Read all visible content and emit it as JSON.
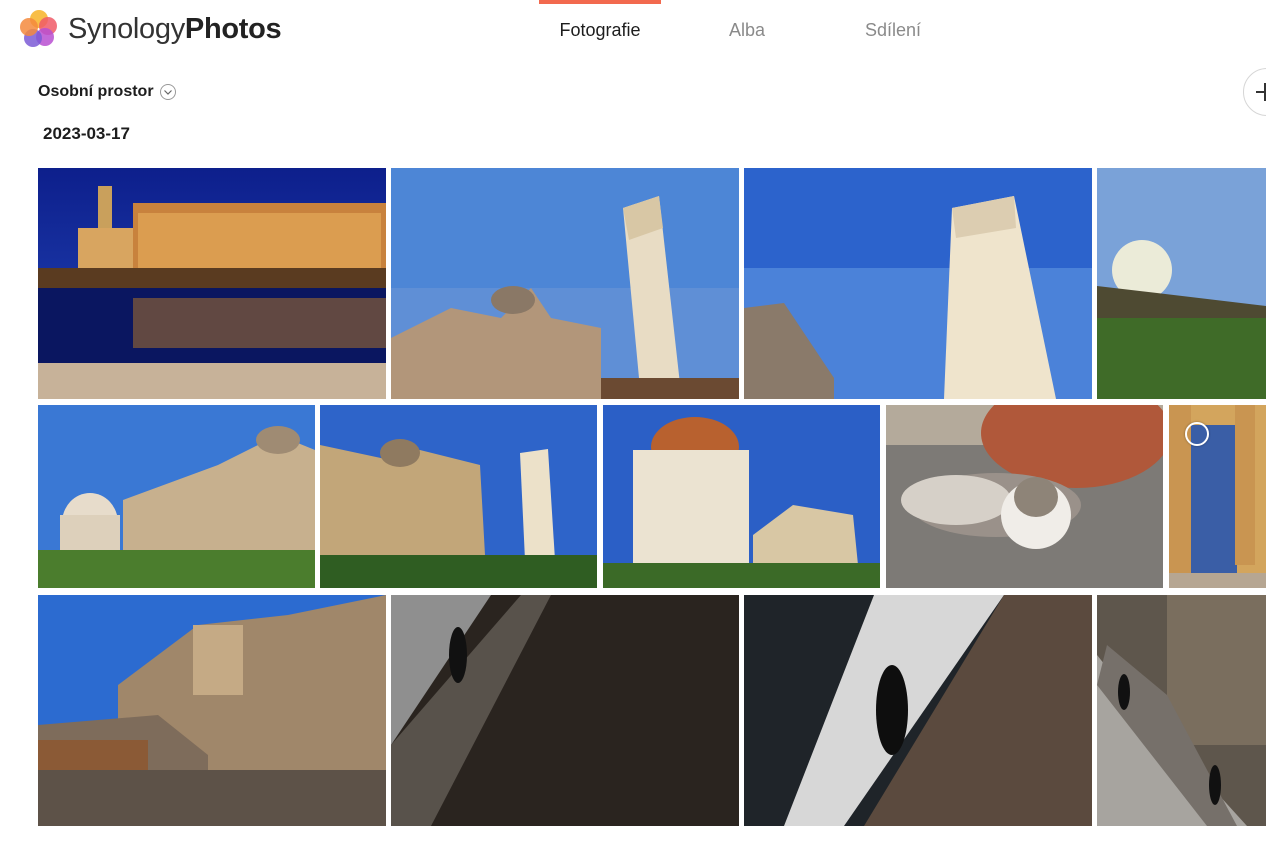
{
  "app": {
    "brand_light": "Synology",
    "brand_bold": "Photos"
  },
  "tabs": [
    {
      "label": "Fotografie",
      "active": true
    },
    {
      "label": "Alba",
      "active": false
    },
    {
      "label": "Sdílení",
      "active": false
    }
  ],
  "space_selector": {
    "label": "Osobní prostor",
    "icon": "chevron-down-icon"
  },
  "toolbar": {
    "add_icon": "plus-icon"
  },
  "gallery": {
    "date_group": "2023-03-17",
    "photos": [
      {
        "name": "pisa-riverfront-night"
      },
      {
        "name": "leaning-tower-cathedral"
      },
      {
        "name": "leaning-tower-closeup"
      },
      {
        "name": "sunset-lawn"
      },
      {
        "name": "baptistery-cathedral-lawn"
      },
      {
        "name": "cathedral-and-tower"
      },
      {
        "name": "baptistery-dome"
      },
      {
        "name": "cat-under-pot"
      },
      {
        "name": "arcade-columns"
      },
      {
        "name": "hilltop-town-viaduct"
      },
      {
        "name": "wall-walker-shadow"
      },
      {
        "name": "walker-silhouette"
      },
      {
        "name": "alley-pedestrians"
      }
    ]
  },
  "colors": {
    "accent": "#f2694e",
    "tab_inactive": "#8a8a8a",
    "text": "#1d1d1d"
  }
}
